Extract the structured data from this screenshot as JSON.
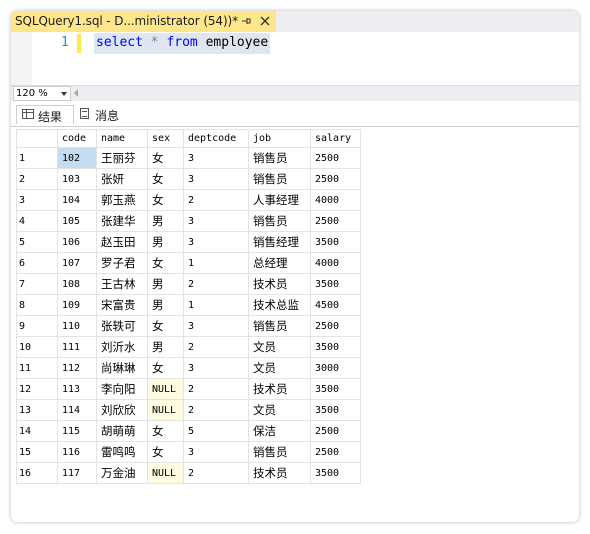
{
  "document_tab": {
    "title": "SQLQuery1.sql - D...ministrator (54))*",
    "pin_icon": "pin-icon",
    "close_icon": "close-icon"
  },
  "editor": {
    "line_number": "1",
    "code_tokens": {
      "kw1": "select",
      "star": "*",
      "kw2": "from",
      "table": "employee"
    }
  },
  "zoom": {
    "value": "120 %"
  },
  "result_tabs": {
    "results_label": "结果",
    "messages_label": "消息"
  },
  "results": {
    "columns": [
      "code",
      "name",
      "sex",
      "deptcode",
      "job",
      "salary"
    ],
    "rows": [
      {
        "n": "1",
        "code": "102",
        "name": "王丽芬",
        "sex": "女",
        "deptcode": "3",
        "job": "销售员",
        "salary": "2500"
      },
      {
        "n": "2",
        "code": "103",
        "name": "张妍",
        "sex": "女",
        "deptcode": "3",
        "job": "销售员",
        "salary": "2500"
      },
      {
        "n": "3",
        "code": "104",
        "name": "郭玉燕",
        "sex": "女",
        "deptcode": "2",
        "job": "人事经理",
        "salary": "4000"
      },
      {
        "n": "4",
        "code": "105",
        "name": "张建华",
        "sex": "男",
        "deptcode": "3",
        "job": "销售员",
        "salary": "2500"
      },
      {
        "n": "5",
        "code": "106",
        "name": "赵玉田",
        "sex": "男",
        "deptcode": "3",
        "job": "销售经理",
        "salary": "3500"
      },
      {
        "n": "6",
        "code": "107",
        "name": "罗子君",
        "sex": "女",
        "deptcode": "1",
        "job": "总经理",
        "salary": "4000"
      },
      {
        "n": "7",
        "code": "108",
        "name": "王古林",
        "sex": "男",
        "deptcode": "2",
        "job": "技术员",
        "salary": "3500"
      },
      {
        "n": "8",
        "code": "109",
        "name": "宋富贵",
        "sex": "男",
        "deptcode": "1",
        "job": "技术总监",
        "salary": "4500"
      },
      {
        "n": "9",
        "code": "110",
        "name": "张轶可",
        "sex": "女",
        "deptcode": "3",
        "job": "销售员",
        "salary": "2500"
      },
      {
        "n": "10",
        "code": "111",
        "name": "刘沂水",
        "sex": "男",
        "deptcode": "2",
        "job": "文员",
        "salary": "3500"
      },
      {
        "n": "11",
        "code": "112",
        "name": "尚琳琳",
        "sex": "女",
        "deptcode": "3",
        "job": "文员",
        "salary": "3000"
      },
      {
        "n": "12",
        "code": "113",
        "name": "李向阳",
        "sex": "NULL",
        "deptcode": "2",
        "job": "技术员",
        "salary": "3500"
      },
      {
        "n": "13",
        "code": "114",
        "name": "刘欣欣",
        "sex": "NULL",
        "deptcode": "2",
        "job": "文员",
        "salary": "3500"
      },
      {
        "n": "14",
        "code": "115",
        "name": "胡萌萌",
        "sex": "女",
        "deptcode": "5",
        "job": "保洁",
        "salary": "2500"
      },
      {
        "n": "15",
        "code": "116",
        "name": "雷鸣鸣",
        "sex": "女",
        "deptcode": "3",
        "job": "销售员",
        "salary": "2500"
      },
      {
        "n": "16",
        "code": "117",
        "name": "万金油",
        "sex": "NULL",
        "deptcode": "2",
        "job": "技术员",
        "salary": "3500"
      }
    ]
  },
  "colors": {
    "tab_active": "#ffe68a",
    "keyword": "#0000ff",
    "line_number": "#2b91af",
    "null_cell": "#fefbe1",
    "selected_cell": "#c5dcef"
  }
}
